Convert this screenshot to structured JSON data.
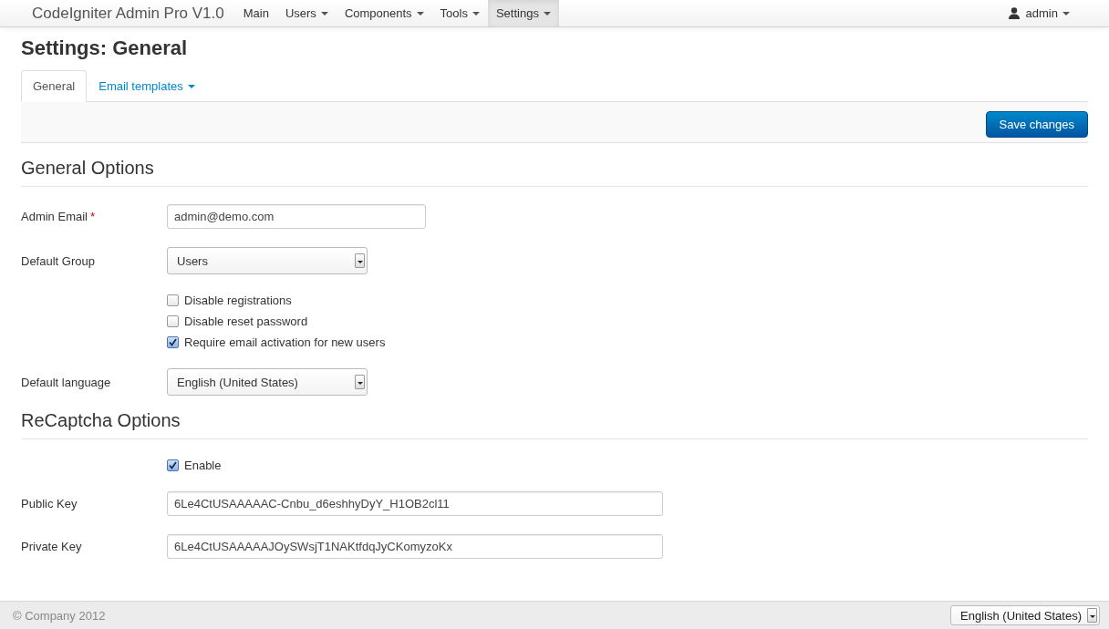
{
  "navbar": {
    "brand": "CodeIgniter Admin Pro V1.0",
    "items": [
      {
        "label": "Main",
        "dropdown": false,
        "selected": false
      },
      {
        "label": "Users",
        "dropdown": true,
        "selected": false
      },
      {
        "label": "Components",
        "dropdown": true,
        "selected": false
      },
      {
        "label": "Tools",
        "dropdown": true,
        "selected": false
      },
      {
        "label": "Settings",
        "dropdown": true,
        "selected": true
      }
    ],
    "user": {
      "label": "admin"
    }
  },
  "page": {
    "title": "Settings: General"
  },
  "tabs": [
    {
      "label": "General",
      "selected": true,
      "dropdown": false
    },
    {
      "label": "Email templates",
      "selected": false,
      "dropdown": true
    }
  ],
  "toolbar": {
    "save_button": "Save changes"
  },
  "sections": [
    {
      "title": "General Options",
      "fields": [
        {
          "kind": "text",
          "label": "Admin Email",
          "required_mark": "*",
          "value": "admin@demo.com"
        },
        {
          "kind": "select",
          "label": "Default Group",
          "value": "Users"
        },
        {
          "kind": "checkboxes",
          "options": [
            {
              "label": "Disable registrations",
              "checked": false
            },
            {
              "label": "Disable reset password",
              "checked": false
            },
            {
              "label": "Require email activation for new users",
              "checked": true
            }
          ]
        },
        {
          "kind": "select",
          "label": "Default language",
          "value": "English (United States)"
        }
      ]
    },
    {
      "title": "ReCaptcha Options",
      "fields": [
        {
          "kind": "checkboxes",
          "options": [
            {
              "label": "Enable",
              "checked": true
            }
          ]
        },
        {
          "kind": "wide_text",
          "label": "Public Key",
          "value": "6Le4CtUSAAAAAC-Cnbu_d6eshhyDyY_H1OB2cl11"
        },
        {
          "kind": "wide_text",
          "label": "Private Key",
          "value": "6Le4CtUSAAAAAJOySWsjT1NAKtfdqJyCKomyzoKx"
        }
      ]
    }
  ],
  "footer": {
    "copyright": "© Company 2012",
    "language_select": "English (United States)"
  }
}
